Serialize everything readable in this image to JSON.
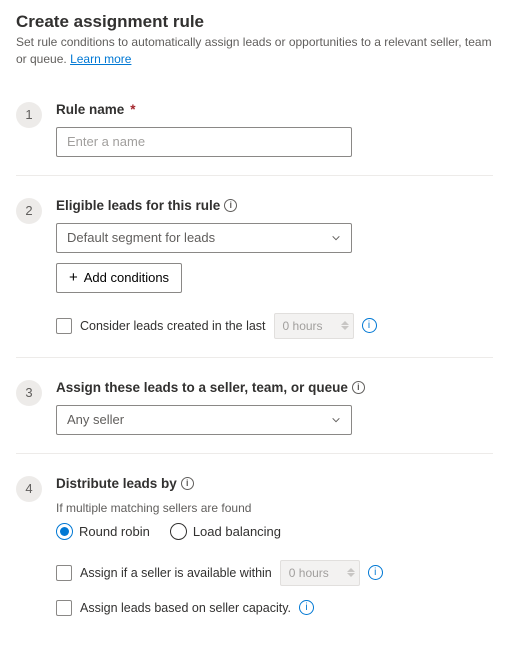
{
  "header": {
    "title": "Create assignment rule",
    "subtitle": "Set rule conditions to automatically assign leads or opportunities to a relevant seller, team or queue.",
    "learn_more": "Learn more"
  },
  "steps": {
    "s1": {
      "num": "1",
      "heading": "Rule name",
      "placeholder": "Enter a name"
    },
    "s2": {
      "num": "2",
      "heading": "Eligible leads for this rule",
      "segment_value": "Default segment for leads",
      "add_conditions": "Add conditions",
      "consider_label": "Consider leads created in the last",
      "hours_value": "0 hours"
    },
    "s3": {
      "num": "3",
      "heading": "Assign these leads to a seller, team, or queue",
      "assignee_value": "Any seller"
    },
    "s4": {
      "num": "4",
      "heading": "Distribute leads by",
      "helper": "If multiple matching sellers are found",
      "option_rr": "Round robin",
      "option_lb": "Load balancing",
      "available_label": "Assign if a seller is available within",
      "available_hours": "0 hours",
      "capacity_label": "Assign leads based on seller capacity."
    }
  }
}
